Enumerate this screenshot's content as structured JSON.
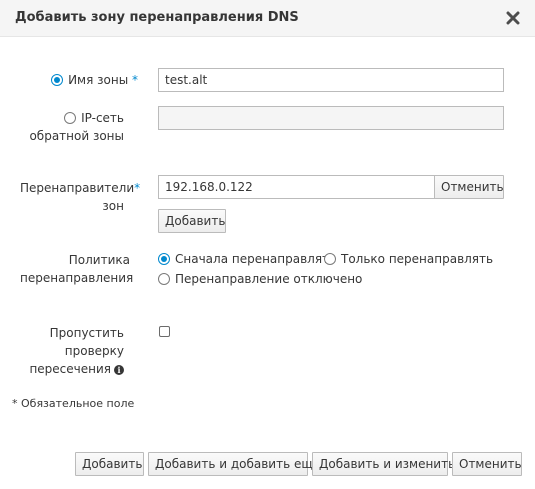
{
  "dialog": {
    "title": "Добавить зону перенаправления DNS",
    "close_icon": "close-icon"
  },
  "form": {
    "zone_type": {
      "zone_name_label": "Имя зоны",
      "zone_name_selected": true,
      "reverse_ip_label_line1": "IP-сеть",
      "reverse_ip_label_line2": "обратной зоны",
      "reverse_ip_selected": false,
      "required_mark": "*"
    },
    "zone_name_value": "test.alt",
    "reverse_ip_value": "",
    "forwarders": {
      "label_line1": "Перенаправители",
      "label_line2": "зон",
      "required_mark": "*",
      "value": "192.168.0.122",
      "undo_label": "Отменить",
      "add_label": "Добавить"
    },
    "policy": {
      "label_line1": "Политика",
      "label_line2": "перенаправления",
      "options": [
        {
          "label": "Сначала перенаправлять",
          "selected": true
        },
        {
          "label": "Только перенаправлять",
          "selected": false
        },
        {
          "label": "Перенаправление отключено",
          "selected": false
        }
      ]
    },
    "skip_overlap": {
      "label_line1": "Пропустить",
      "label_line2": "проверку",
      "label_line3": "пересечения",
      "checked": false,
      "info_icon": "info-icon"
    }
  },
  "required_note": "* Обязательное поле",
  "footer": {
    "add_label": "Добавить",
    "add_and_add_another_label": "Добавить и добавить ещё",
    "add_and_edit_label": "Добавить и изменить",
    "cancel_label": "Отменить"
  },
  "colors": {
    "accent": "#0088ce",
    "header_bg": "#f5f5f5"
  }
}
